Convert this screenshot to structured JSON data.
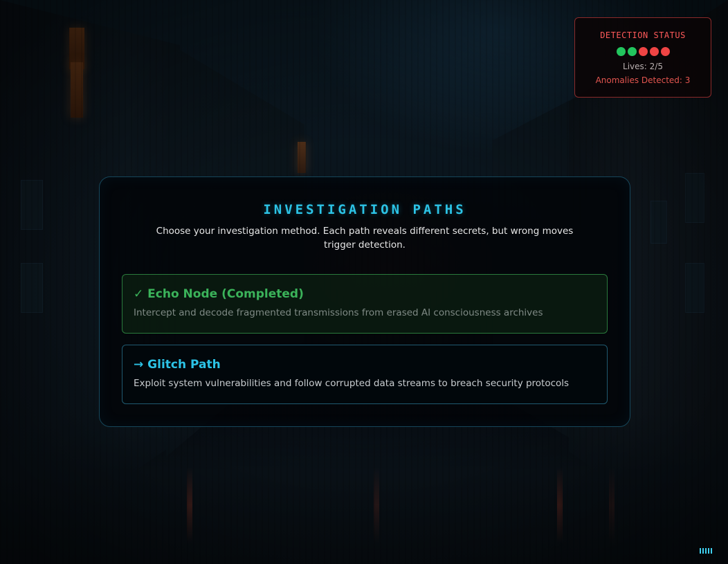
{
  "status": {
    "title": "DETECTION STATUS",
    "lives_text": "Lives: 2/5",
    "anomalies_text": "Anomalies Detected: 3",
    "lives_total": 5,
    "lives_remaining": 2,
    "colors": {
      "life_active": "#22c55e",
      "life_lost": "#ef4444",
      "border": "#8a2a2a",
      "title": "#ff5a5a"
    }
  },
  "investigation": {
    "title": "INVESTIGATION PATHS",
    "subtitle": "Choose your investigation method. Each path reveals different secrets, but wrong moves trigger detection.",
    "paths": [
      {
        "title": "✓ Echo Node (Completed)",
        "description": "Intercept and decode fragmented transmissions from erased AI consciousness archives",
        "state": "completed"
      },
      {
        "title": "→ Glitch Path",
        "description": "Exploit system vulnerabilities and follow corrupted data streams to breach security protocols",
        "state": "available"
      }
    ]
  },
  "signal_indicator": {
    "icon": "signal-bars-icon",
    "bars": 5,
    "color": "#3fd0f0"
  },
  "theme": {
    "accent": "#2cc3e6",
    "completed": "#3bb35a",
    "danger": "#ef4444"
  }
}
